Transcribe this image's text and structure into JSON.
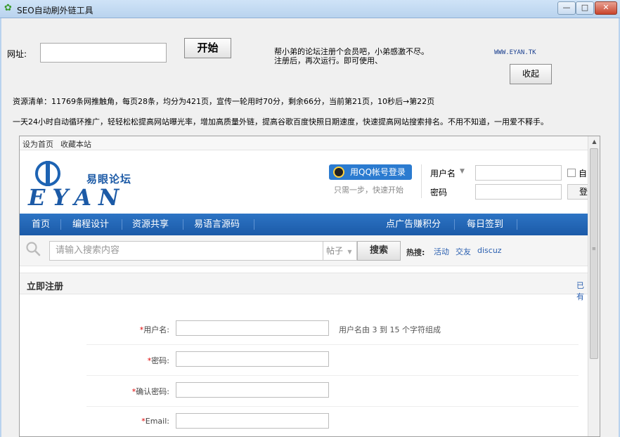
{
  "window": {
    "title": "SEO自动刷外链工具",
    "min_glyph": "—",
    "max_glyph": "□",
    "close_glyph": "✕"
  },
  "controls": {
    "url_label": "网址:",
    "url_value": "",
    "start_button": "开始",
    "notice_line1": "帮小弟的论坛注册个会员吧，小弟感激不尽。",
    "notice_line2": "注册后，再次运行。即可使用、",
    "site_link": "WWW.EYAN.TK",
    "collapse_button": "收起",
    "status_line": "资源清单：11769条网推触角，每页28条，均分为421页，宣传一轮用时70分，剩余66分，当前第21页，10秒后→第22页",
    "promo_line": "一天24小时自动循环推广，轻轻松松提高网站曝光率，增加高质量外链，提高谷歌百度快照日期速度，快速提高网站搜索排名。不用不知道，一用爱不释手。"
  },
  "browser": {
    "top_links": [
      "设为首页",
      "收藏本站"
    ],
    "logo_cn": "易眼论坛",
    "logo_en": "EYAN",
    "qq_login": "用QQ帐号登录",
    "qq_sub": "只需一步，快速开始",
    "username_label": "用户名",
    "password_label": "密码",
    "auto_label": "自",
    "login_button": "登",
    "nav": [
      "首页",
      "编程设计",
      "资源共享",
      "易语言源码",
      "点广告赚积分",
      "每日签到"
    ],
    "search_placeholder": "请输入搜索内容",
    "search_type": "帖子",
    "search_button": "搜索",
    "hot_label": "热搜:",
    "hot_links": [
      "活动",
      "交友",
      "discuz"
    ],
    "register_title": "立即注册",
    "register_right": "已有",
    "form": [
      {
        "label": "用户名:",
        "hint": "用户名由 3 到 15 个字符组成"
      },
      {
        "label": "密码:",
        "hint": ""
      },
      {
        "label": "确认密码:",
        "hint": ""
      },
      {
        "label": "Email:",
        "hint": ""
      }
    ],
    "required_mark": "*"
  },
  "colors": {
    "nav_blue": "#1b5aa8",
    "logo_blue": "#1c5aa6",
    "qq_blue": "#2b7bd0",
    "link_blue": "#2a5fb0",
    "required_red": "#dd0000"
  }
}
